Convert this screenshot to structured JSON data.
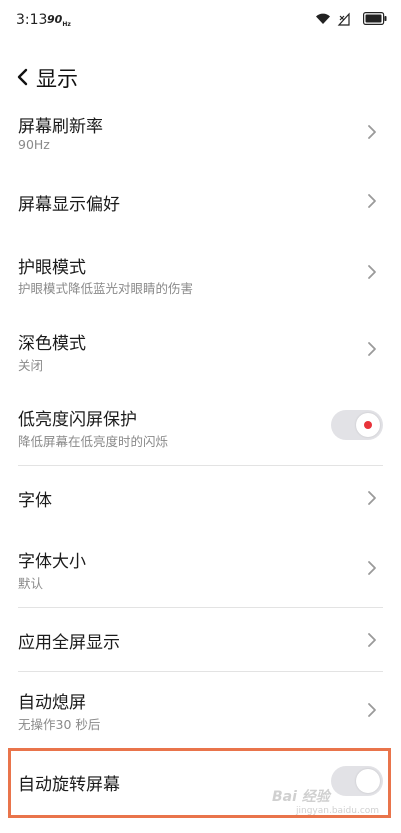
{
  "status_bar": {
    "time": "3:13",
    "network": "90",
    "network_suffix": "Hz"
  },
  "header": {
    "back_icon": "chevron-left-icon",
    "title": "显示"
  },
  "settings": [
    {
      "title": "屏幕刷新率",
      "subtitle": "90Hz",
      "control": "chevron"
    },
    {
      "title": "屏幕显示偏好",
      "subtitle": "",
      "control": "chevron"
    },
    {
      "title": "护眼模式",
      "subtitle": "护眼模式降低蓝光对眼睛的伤害",
      "control": "chevron"
    },
    {
      "title": "深色模式",
      "subtitle": "关闭",
      "control": "chevron"
    },
    {
      "title": "低亮度闪屏保护",
      "subtitle": "降低屏幕在低亮度时的闪烁",
      "control": "toggle",
      "enabled": true
    },
    {
      "title": "字体",
      "subtitle": "",
      "control": "chevron"
    },
    {
      "title": "字体大小",
      "subtitle": "默认",
      "control": "chevron"
    },
    {
      "title": "应用全屏显示",
      "subtitle": "",
      "control": "chevron"
    },
    {
      "title": "自动熄屏",
      "subtitle": "无操作30 秒后",
      "control": "chevron"
    },
    {
      "title": "自动旋转屏幕",
      "subtitle": "",
      "control": "toggle",
      "enabled": false
    }
  ],
  "colors": {
    "toggle_on_dot": "#e8333a",
    "toggle_track": "#e2e2e6",
    "highlight": "#e9744b"
  },
  "watermark": {
    "brand": "Bai 经验",
    "url": "jingyan.baidu.com"
  }
}
